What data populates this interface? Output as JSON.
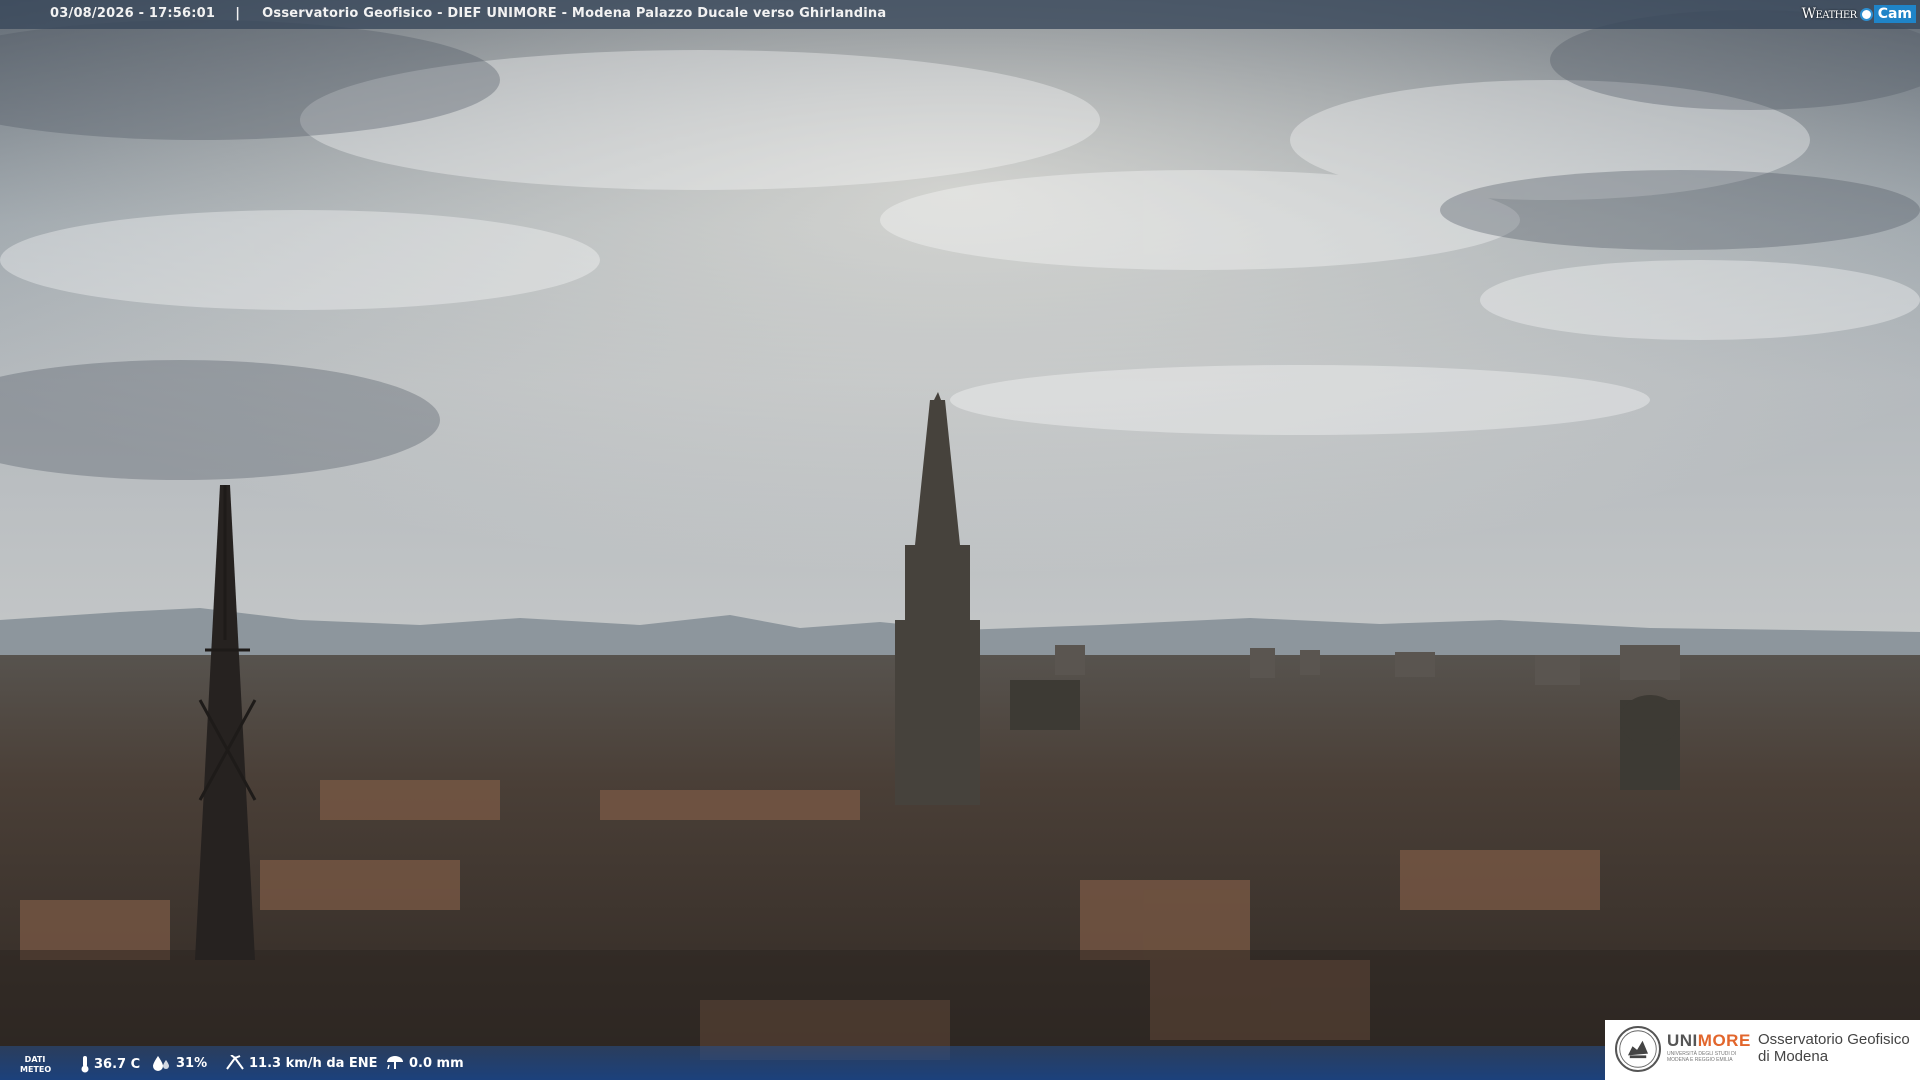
{
  "overlay": {
    "datetime": "03/08/2026 - 17:56:01",
    "separator": "|",
    "camera_title": "Osservatorio Geofisico - DIEF UNIMORE - Modena Palazzo Ducale verso Ghirlandina",
    "brand_weather": "Weather",
    "brand_cam": "Cam"
  },
  "meteo": {
    "label_line1": "DATI",
    "label_line2": "METEO",
    "temperature": "36.7 C",
    "humidity": "31%",
    "wind": "11.3 km/h da ENE",
    "rain": "0.0 mm"
  },
  "logo": {
    "unimore_left": "UNI",
    "unimore_right": "MORE",
    "unimore_sub": "UNIVERSITÀ DEGLI STUDI DI MODENA E REGGIO EMILIA",
    "observatory_line1": "Osservatorio Geofisico",
    "observatory_line2": "di Modena"
  },
  "colors": {
    "overlay_bar": "#37465a",
    "bottom_bar": "#1f468c",
    "unimore_accent": "#e2662c"
  },
  "icons": [
    "thermometer-icon",
    "humidity-drop-icon",
    "wind-icon",
    "rain-gauge-icon",
    "university-seal-icon"
  ]
}
